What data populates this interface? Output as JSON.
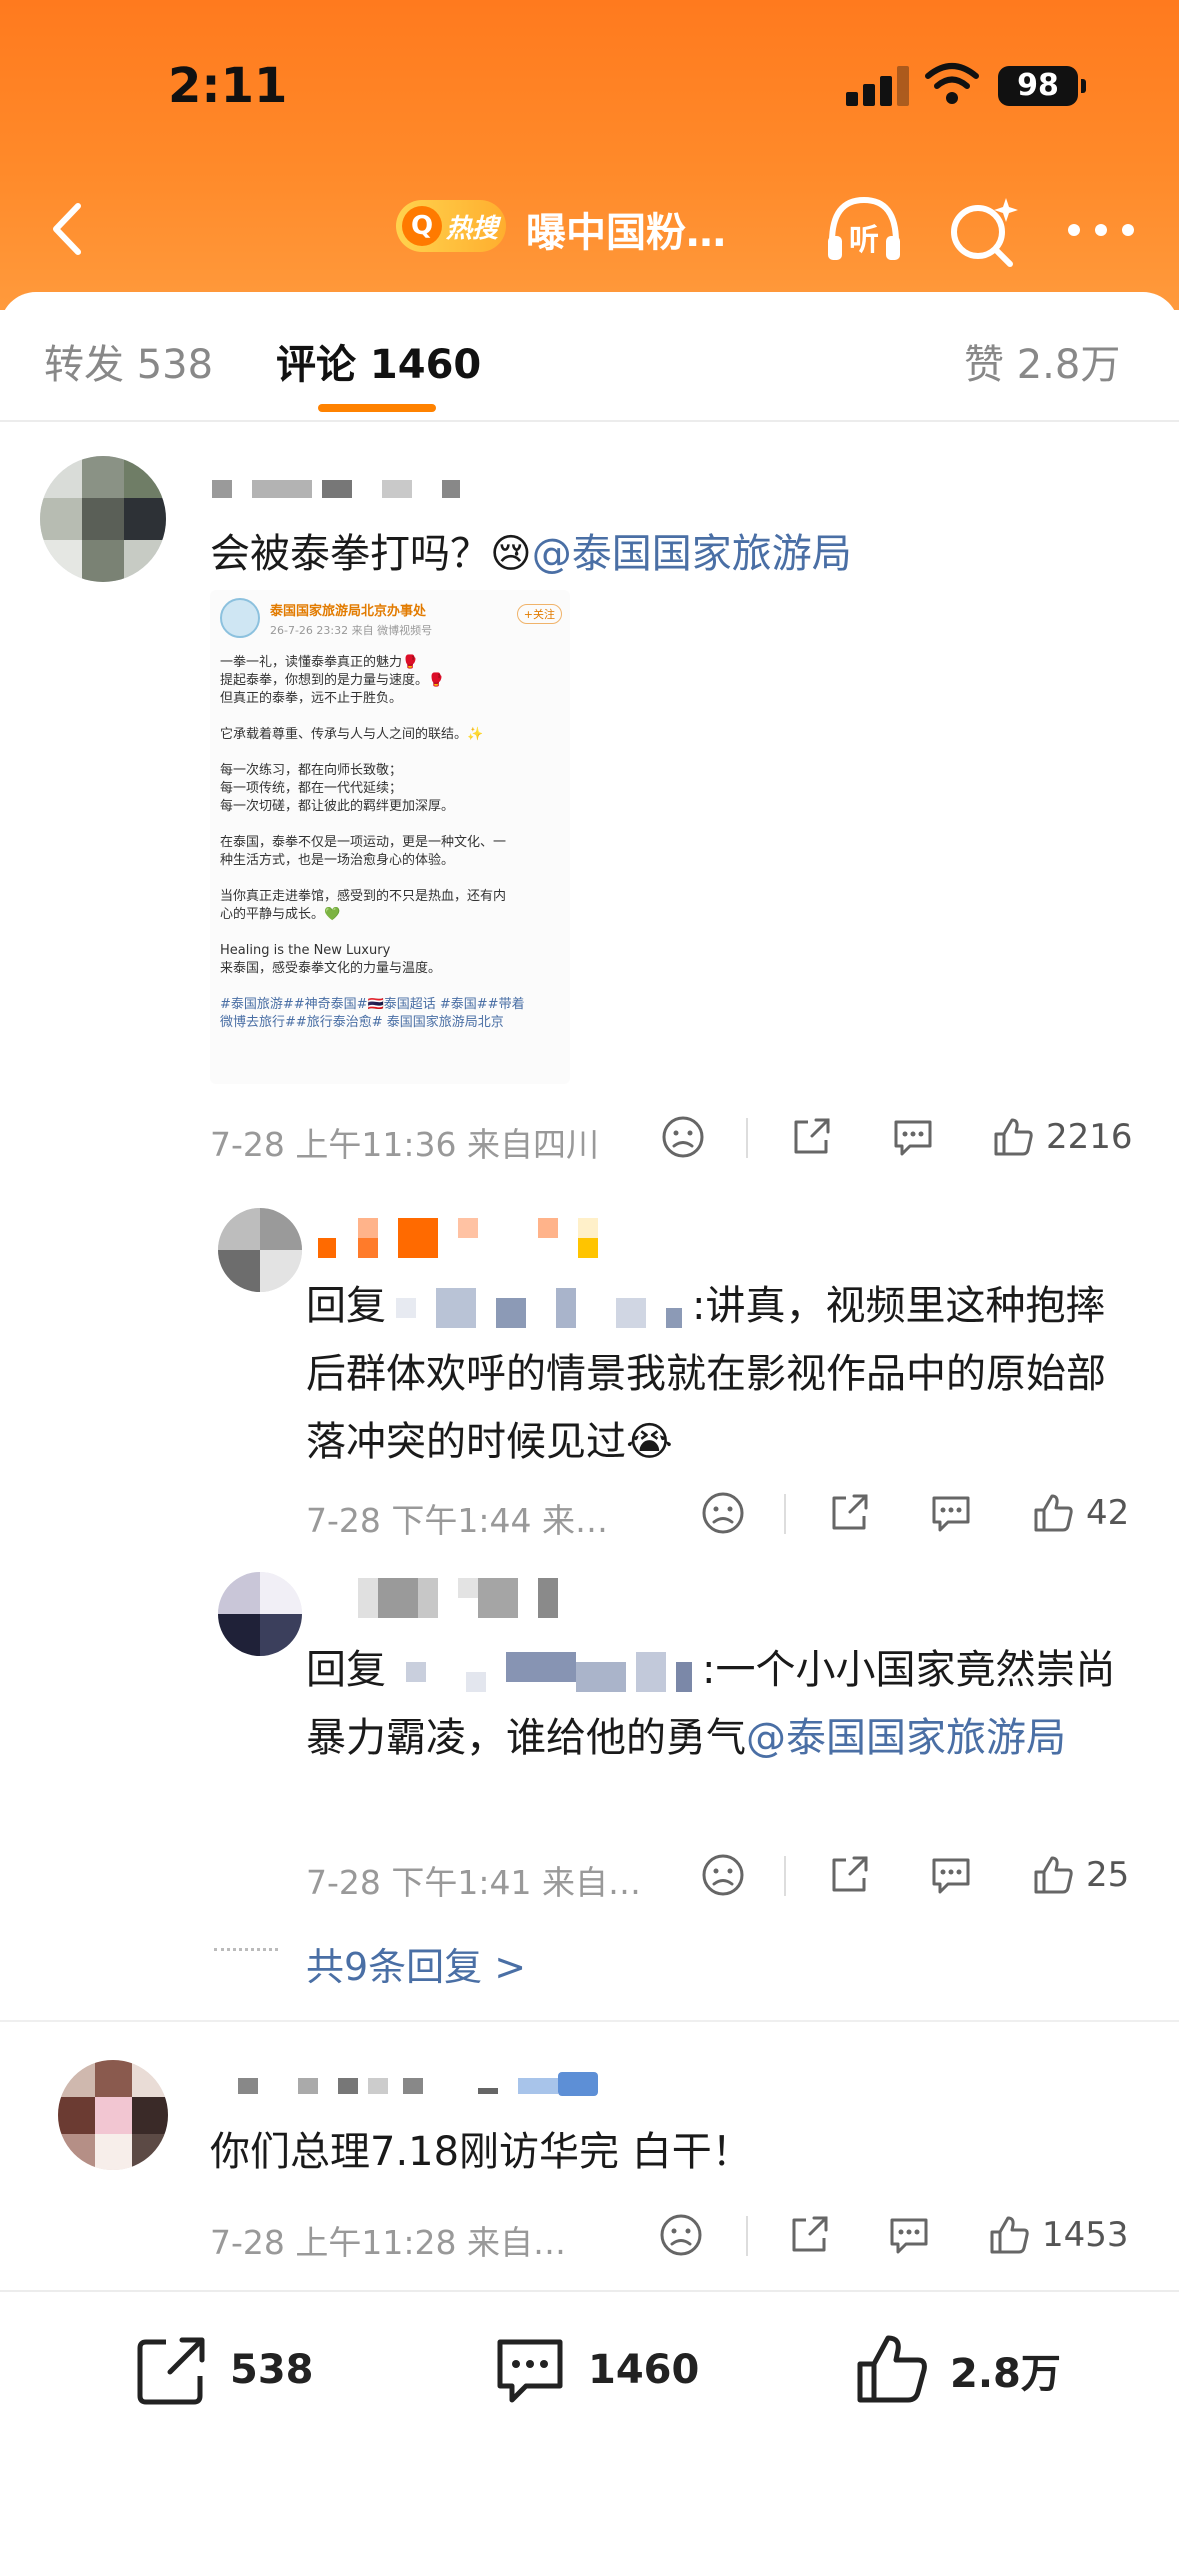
{
  "status_bar": {
    "time": "2:11",
    "battery": "98"
  },
  "nav": {
    "hot_badge": "热搜",
    "title": "曝中国粉…"
  },
  "tabs": {
    "repost": "转发 538",
    "comments": "评论 1460",
    "likes": "赞 2.8万"
  },
  "comments": [
    {
      "text": "会被泰拳打吗？",
      "emoji": "😢",
      "mention": "@泰国国家旅游局",
      "timestamp": "7-28 上午11:36 来自四川",
      "likes": "2216",
      "card": {
        "account": "泰国国家旅游局北京办事处",
        "follow": "+关注",
        "meta": "26-7-26 23:32  来自 微博视频号",
        "lines": [
          "一拳一礼，读懂泰拳真正的魅力🥊",
          "提起泰拳，你想到的是力量与速度。🥊",
          "但真正的泰拳，远不止于胜负。",
          "",
          "它承载着尊重、传承与人与人之间的联结。✨",
          "",
          "每一次练习，都在向师长致敬；",
          "每一项传统，都在一代代延续；",
          "每一次切磋，都让彼此的羁绊更加深厚。",
          "",
          "在泰国，泰拳不仅是一项运动，更是一种文化、一",
          "种生活方式，也是一场治愈身心的体验。",
          "",
          "当你真正走进拳馆，感受到的不只是热血，还有内",
          "心的平静与成长。💚",
          "",
          "Healing is the New Luxury",
          "来泰国，感受泰拳文化的力量与温度。",
          "",
          "#泰国旅游##神奇泰国#🇹🇭泰国超话 #泰国##带着",
          "微博去旅行##旅行泰治愈# 泰国国家旅游局北京"
        ]
      },
      "replies": [
        {
          "prefix": "回复",
          "text": ":讲真，视频里这种抱摔后群体欢呼的情景我就在影视作品中的原始部落冲突的时候见过",
          "emoji": "😭",
          "timestamp": "7-28 下午1:44 来…",
          "likes": "42"
        },
        {
          "prefix": "回复",
          "text": ":一个小小国家竟然崇尚暴力霸凌，谁给他的勇气",
          "mention": "@泰国国家旅游局",
          "timestamp": "7-28 下午1:41 来自…",
          "likes": "25"
        }
      ],
      "replies_link": "共9条回复 >"
    },
    {
      "text": "你们总理7.18刚访华完 白干！",
      "timestamp": "7-28 上午11:28 来自…",
      "likes": "1453"
    }
  ],
  "bottom_bar": {
    "repost": "538",
    "comment": "1460",
    "like": "2.8万"
  },
  "colors": {
    "header": "#ff7a1e",
    "accent": "#ff8200",
    "link": "#4a6fa5"
  }
}
